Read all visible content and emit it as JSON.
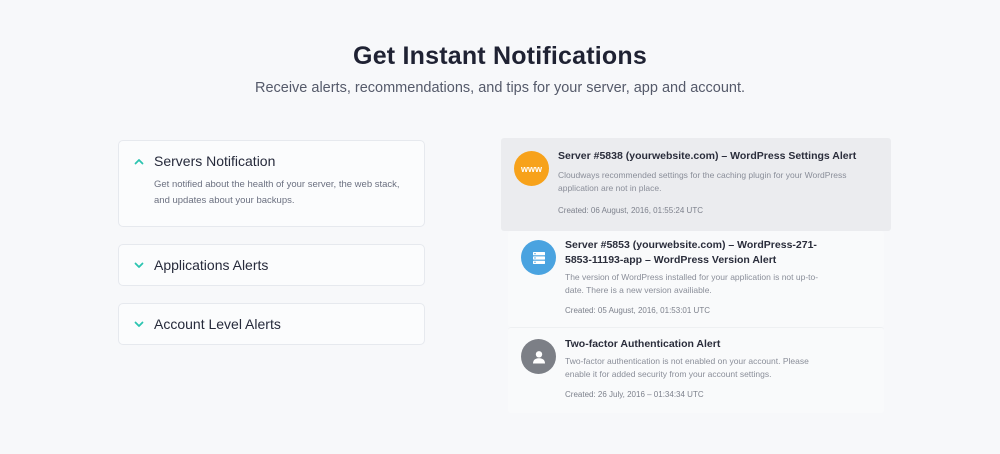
{
  "header": {
    "title": "Get Instant Notifications",
    "subtitle": "Receive alerts, recommendations, and tips for your server, app and account."
  },
  "accordion": [
    {
      "title": "Servers Notification",
      "expanded": true,
      "body": "Get notified about the health of your server, the web stack, and updates about your backups."
    },
    {
      "title": "Applications Alerts",
      "expanded": false
    },
    {
      "title": "Account Level Alerts",
      "expanded": false
    }
  ],
  "notifications": [
    {
      "icon": "www-icon",
      "icon_text": "www",
      "color": "#f7a21b",
      "title": "Server #5838 (yourwebsite.com) – WordPress Settings Alert",
      "description": "Cloudways recommended settings for the caching plugin for your WordPress application are not in place.",
      "date": "Created: 06 August, 2016, 01:55:24 UTC"
    },
    {
      "icon": "server-icon",
      "color": "#4aa3e0",
      "title": "Server #5853 (yourwebsite.com) – WordPress-271-5853-11193-app – WordPress Version Alert",
      "description": "The version of WordPress installed for your application is not up-to-date. There is a new version availiable.",
      "date": "Created: 05 August, 2016, 01:53:01 UTC"
    },
    {
      "icon": "user-icon",
      "color": "#7c7f86",
      "title": "Two-factor Authentication Alert",
      "description": "Two-factor authentication is not enabled on your account. Please enable it for added security from your account settings.",
      "date": "Created: 26 July, 2016 – 01:34:34 UTC"
    }
  ],
  "accent_color": "#2bc4b0"
}
